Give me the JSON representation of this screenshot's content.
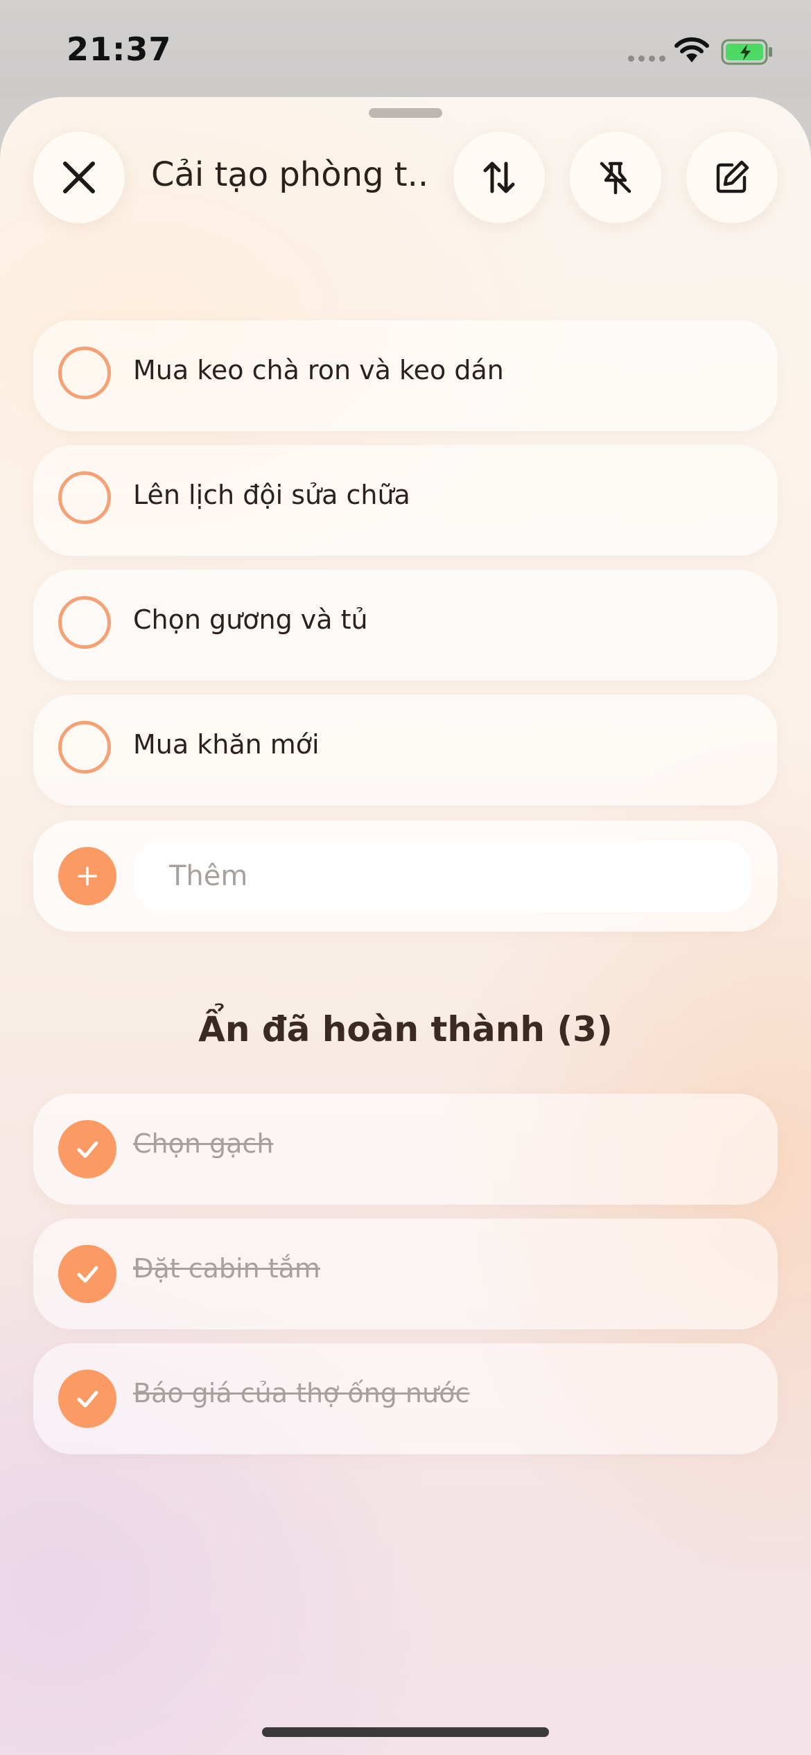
{
  "status_bar": {
    "time": "21:37"
  },
  "header": {
    "title": "Cải tạo phòng t...",
    "buttons": [
      "close-icon",
      "sort-icon",
      "unpin-icon",
      "edit-icon"
    ]
  },
  "colors": {
    "accent": "#fb9a63",
    "ring": "#f5a174",
    "text": "#2b211c",
    "done_text": "#a7a09c"
  },
  "tasks": [
    {
      "label": "Mua keo chà ron và keo dán",
      "done": false
    },
    {
      "label": "Lên lịch đội sửa chữa",
      "done": false
    },
    {
      "label": "Chọn gương và tủ",
      "done": false
    },
    {
      "label": "Mua khăn mới",
      "done": false
    }
  ],
  "add": {
    "placeholder": "Thêm"
  },
  "completed": {
    "toggle_label": "Ẩn đã hoàn thành (3)",
    "items": [
      {
        "label": "Chọn gạch",
        "done": true
      },
      {
        "label": "Đặt cabin tắm",
        "done": true
      },
      {
        "label": "Báo giá của thợ ống nước",
        "done": true
      }
    ]
  }
}
